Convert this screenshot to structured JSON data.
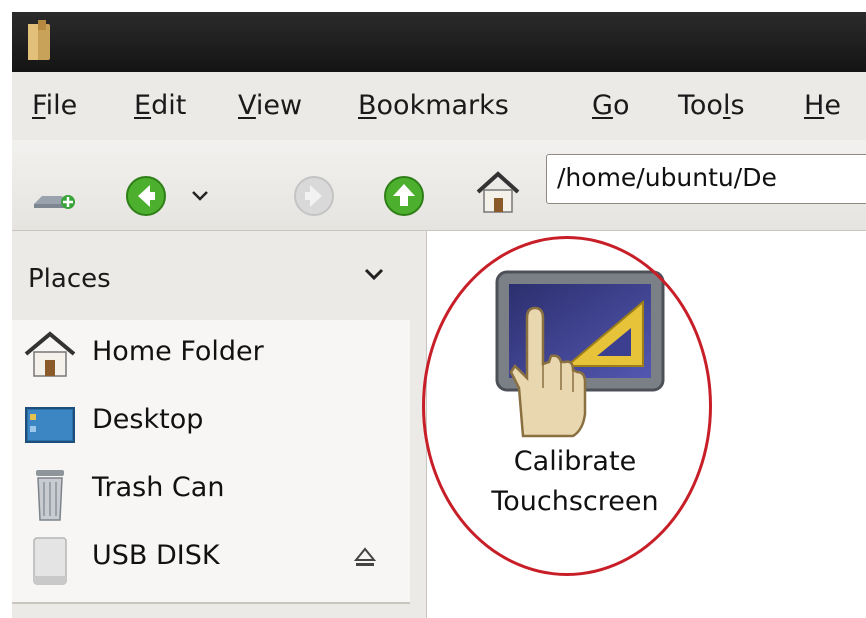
{
  "menubar": {
    "items": [
      {
        "accel": "F",
        "rest": "ile"
      },
      {
        "accel": "E",
        "rest": "dit"
      },
      {
        "accel": "V",
        "rest": "iew"
      },
      {
        "accel": "B",
        "rest": "ookmarks"
      },
      {
        "accel": "G",
        "rest": "o"
      },
      {
        "pre": "Too",
        "accel": "l",
        "rest": "s"
      },
      {
        "accel": "H",
        "rest": "e"
      }
    ]
  },
  "toolbar": {
    "location": "/home/ubuntu/De",
    "icons": [
      "new-tab-icon",
      "back-icon",
      "history-dropdown-icon",
      "forward-icon",
      "up-icon",
      "home-icon"
    ]
  },
  "sidebar": {
    "header": "Places",
    "items": [
      {
        "label": "Home Folder",
        "icon": "home-icon"
      },
      {
        "label": "Desktop",
        "icon": "desktop-icon"
      },
      {
        "label": "Trash Can",
        "icon": "trash-icon"
      },
      {
        "label": "USB DISK",
        "icon": "usb-drive-icon"
      }
    ]
  },
  "files": [
    {
      "label": "Calibrate Touchscreen",
      "icon": "calibrate-touchscreen-icon"
    }
  ],
  "colors": {
    "highlight": "#c81e28",
    "titlebar": "#1e1e1e",
    "menubar": "#eceae6"
  }
}
